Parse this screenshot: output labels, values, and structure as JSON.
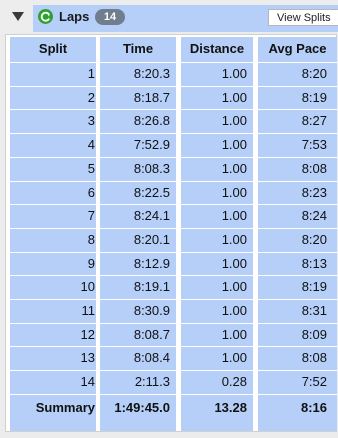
{
  "header": {
    "title": "Laps",
    "count_badge": "14",
    "view_splits_label": "View Splits",
    "icon": "refresh-circle-icon",
    "accent_color": "#b5cff9"
  },
  "table": {
    "columns": [
      "Split",
      "Time",
      "Distance",
      "Avg Pace"
    ],
    "rows": [
      {
        "split": "1",
        "time": "8:20.3",
        "distance": "1.00",
        "pace": "8:20"
      },
      {
        "split": "2",
        "time": "8:18.7",
        "distance": "1.00",
        "pace": "8:19"
      },
      {
        "split": "3",
        "time": "8:26.8",
        "distance": "1.00",
        "pace": "8:27"
      },
      {
        "split": "4",
        "time": "7:52.9",
        "distance": "1.00",
        "pace": "7:53"
      },
      {
        "split": "5",
        "time": "8:08.3",
        "distance": "1.00",
        "pace": "8:08"
      },
      {
        "split": "6",
        "time": "8:22.5",
        "distance": "1.00",
        "pace": "8:23"
      },
      {
        "split": "7",
        "time": "8:24.1",
        "distance": "1.00",
        "pace": "8:24"
      },
      {
        "split": "8",
        "time": "8:20.1",
        "distance": "1.00",
        "pace": "8:20"
      },
      {
        "split": "9",
        "time": "8:12.9",
        "distance": "1.00",
        "pace": "8:13"
      },
      {
        "split": "10",
        "time": "8:19.1",
        "distance": "1.00",
        "pace": "8:19"
      },
      {
        "split": "11",
        "time": "8:30.9",
        "distance": "1.00",
        "pace": "8:31"
      },
      {
        "split": "12",
        "time": "8:08.7",
        "distance": "1.00",
        "pace": "8:09"
      },
      {
        "split": "13",
        "time": "8:08.4",
        "distance": "1.00",
        "pace": "8:08"
      },
      {
        "split": "14",
        "time": "2:11.3",
        "distance": "0.28",
        "pace": "7:52"
      }
    ],
    "summary": {
      "split": "Summary",
      "time": "1:49:45.0",
      "distance": "13.28",
      "pace": "8:16"
    }
  }
}
